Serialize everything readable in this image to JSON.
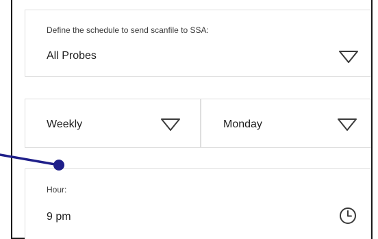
{
  "schedule": {
    "label": "Define the schedule to send scanfile to SSA:",
    "probe_value": "All Probes"
  },
  "frequency": {
    "value": "Weekly"
  },
  "day": {
    "value": "Monday"
  },
  "hour": {
    "label": "Hour:",
    "value": "9 pm"
  },
  "icons": {
    "dropdown": "chevron-down-triangle-icon",
    "time": "clock-icon"
  },
  "colors": {
    "annotation": "#1f1f8a",
    "border": "#dedede",
    "icon": "#3a3a3a"
  }
}
